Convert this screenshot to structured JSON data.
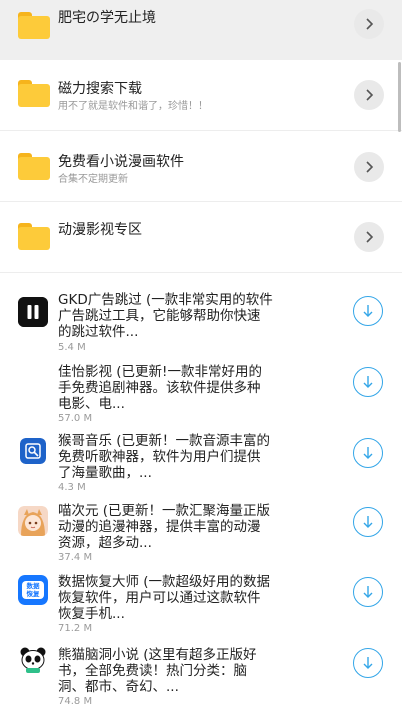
{
  "folders": [
    {
      "title": "肥宅の学无止境",
      "subtitle": ""
    },
    {
      "title": "磁力搜索下载",
      "subtitle": "用不了就是软件和谐了，珍惜！！"
    },
    {
      "title": "免费看小说漫画软件",
      "subtitle": "合集不定期更新"
    },
    {
      "title": "动漫影视专区",
      "subtitle": ""
    }
  ],
  "apps": [
    {
      "line1": "GKD广告跳过 (一款非常实用的软件",
      "line2": "广告跳过工具，它能够帮助你快速",
      "line3": "的跳过软件...",
      "size": "5.4 M",
      "icon": "gkd-pause-icon"
    },
    {
      "line1": "佳怡影视 (已更新!一款非常好用的",
      "line2": "手免费追剧神器。该软件提供多种",
      "line3": "电影、电...",
      "size": "57.0 M",
      "icon": "blank-icon"
    },
    {
      "line1": "猴哥音乐 (已更新！一款音源丰富的",
      "line2": "免费听歌神器，软件为用户们提供",
      "line3": "了海量歌曲，...",
      "size": "4.3 M",
      "icon": "music-search-icon"
    },
    {
      "line1": "喵次元 (已更新！一款汇聚海量正版",
      "line2": "动漫的追漫神器，提供丰富的动漫",
      "line3": "资源，超多动...",
      "size": "37.4 M",
      "icon": "anime-girl-icon"
    },
    {
      "line1": "数据恢复大师 (一款超级好用的数据",
      "line2": "恢复软件，用户可以通过这款软件",
      "line3": "恢复手机...",
      "size": "71.2 M",
      "icon": "data-recovery-icon"
    },
    {
      "line1": "熊猫脑洞小说 (这里有超多正版好",
      "line2": "书，全部免费读！热门分类：脑",
      "line3": "洞、都市、奇幻、...",
      "size": "74.8 M",
      "icon": "panda-icon"
    }
  ],
  "icon_texts": {
    "data_recovery": "数据\n恢复"
  },
  "colors": {
    "accent": "#34a6e8",
    "folder": "#fdcb3a",
    "folder_tab": "#f6b41c"
  }
}
